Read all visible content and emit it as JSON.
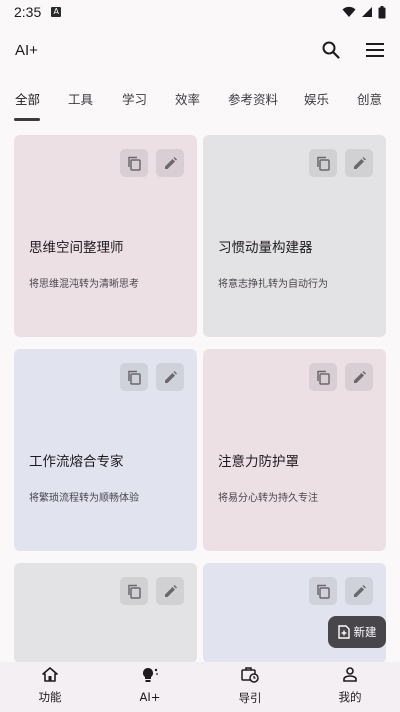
{
  "status_bar": {
    "time": "2:35",
    "notification_letter": "A"
  },
  "app_bar": {
    "title": "AI+"
  },
  "tabs": [
    {
      "label": "全部",
      "active": true
    },
    {
      "label": "工具"
    },
    {
      "label": "学习"
    },
    {
      "label": "效率"
    },
    {
      "label": "参考资料"
    },
    {
      "label": "娱乐"
    },
    {
      "label": "创意"
    }
  ],
  "cards": [
    {
      "title": "思维空间整理师",
      "desc": "将思维混沌转为清晰思考",
      "color": "#ece0e5"
    },
    {
      "title": "习惯动量构建器",
      "desc": "将意志挣扎转为自动行为",
      "color": "#e3e2e4"
    },
    {
      "title": "工作流熔合专家",
      "desc": "将繁琐流程转为顺畅体验",
      "color": "#e1e3ee"
    },
    {
      "title": "注意力防护罩",
      "desc": "将易分心转为持久专注",
      "color": "#ece0e5"
    },
    {
      "title": "",
      "desc": "",
      "color": "#e3e2e4"
    },
    {
      "title": "",
      "desc": "",
      "color": "#e1e3ee"
    }
  ],
  "fab": {
    "label": "新建"
  },
  "bottom_nav": [
    {
      "label": "功能",
      "icon": "home-icon"
    },
    {
      "label": "AI+",
      "icon": "lightbulb-icon"
    },
    {
      "label": "导引",
      "icon": "work-history-icon"
    },
    {
      "label": "我的",
      "icon": "person-icon"
    }
  ]
}
